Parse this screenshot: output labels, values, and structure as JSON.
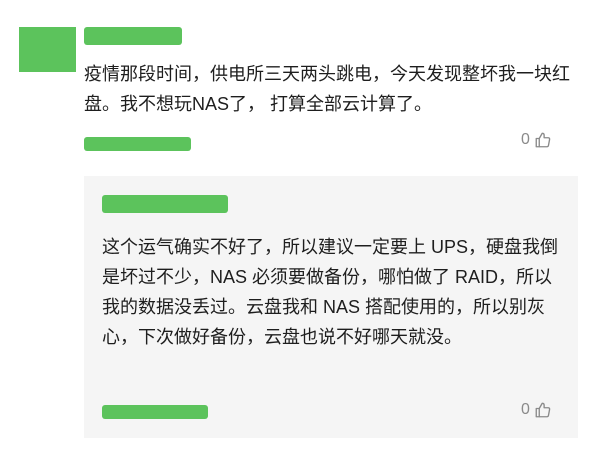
{
  "comment": {
    "text": "疫情那段时间，供电所三天两头跳电，今天发现整坏我一块红盘。我不想玩NAS了， 打算全部云计算了。",
    "like_count": "0",
    "like_icon": "thumbs-up-icon",
    "avatar_color": "#5cc35c"
  },
  "reply": {
    "text": "这个运气确实不好了，所以建议一定要上 UPS，硬盘我倒是坏过不少，NAS 必须要做备份，哪怕做了 RAID，所以我的数据没丢过。云盘我和 NAS 搭配使用的，所以别灰心，下次做好备份，云盘也说不好哪天就没。",
    "like_count": "0",
    "like_icon": "thumbs-up-icon",
    "background": "#f5f5f5"
  },
  "redaction_color": "#5cc35c"
}
